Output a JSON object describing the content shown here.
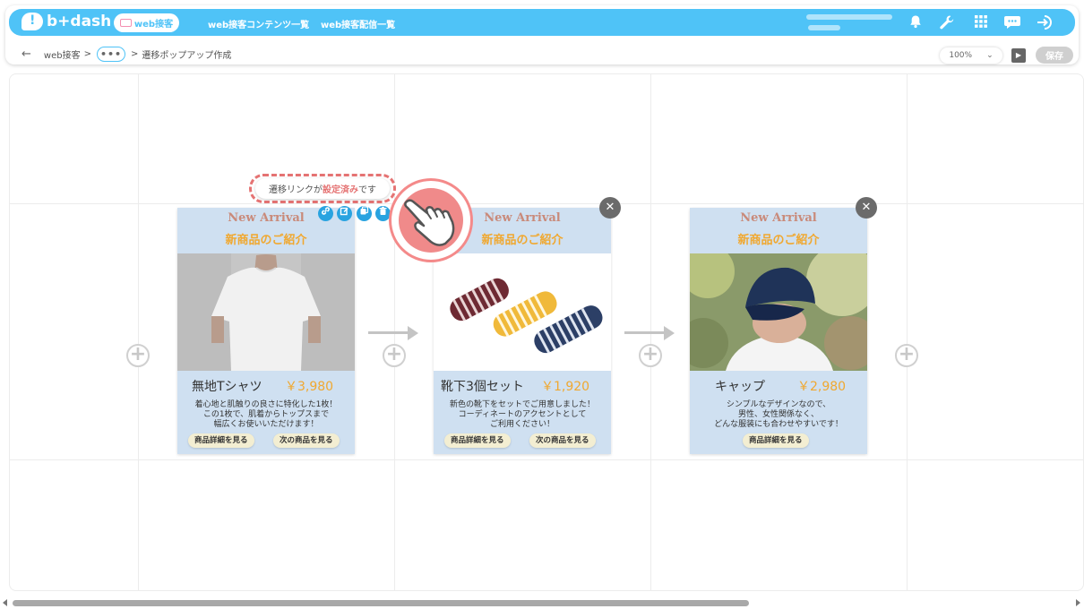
{
  "app": {
    "logo_text": "b+dash",
    "nav_active": "web接客",
    "nav_links": [
      "web接客コンテンツ一覧",
      "web接客配信一覧"
    ]
  },
  "breadcrumb": {
    "root": "web接客",
    "sep": ">",
    "more": "•••",
    "current": "遷移ポップアップ作成"
  },
  "toolbar": {
    "zoom_value": "100%",
    "save_label": "保存"
  },
  "tooltip": {
    "pre": "遷移リンクが",
    "highlight": "設定済み",
    "post": "です"
  },
  "cards": [
    {
      "arrival": "New Arrival",
      "intro": "新商品のご紹介",
      "name": "無地Tシャツ",
      "price": "￥3,980",
      "desc": [
        "着心地と肌触りの良さに特化した1枚！",
        "この1枚で、肌着からトップスまで",
        "幅広くお使いいただけます！"
      ],
      "btn_detail": "商品詳細を見る",
      "btn_next": "次の商品を見る"
    },
    {
      "arrival": "New Arrival",
      "intro": "新商品のご紹介",
      "name": "靴下3個セット",
      "price": "￥1,920",
      "desc": [
        "新色の靴下をセットでご用意しました！",
        "コーディネートのアクセントとして",
        "ご利用ください！"
      ],
      "btn_detail": "商品詳細を見る",
      "btn_next": "次の商品を見る"
    },
    {
      "arrival": "New Arrival",
      "intro": "新商品のご紹介",
      "name": "キャップ",
      "price": "￥2,980",
      "desc": [
        "シンプルなデザインなので、",
        "男性、女性関係なく、",
        "どんな服装にも合わせやすいです！"
      ],
      "btn_detail": "商品詳細を見る"
    }
  ],
  "colors": {
    "accent": "#4fc3f7",
    "card_bg": "#cfe0f1",
    "highlight": "#e57373",
    "price": "#f0a830"
  }
}
